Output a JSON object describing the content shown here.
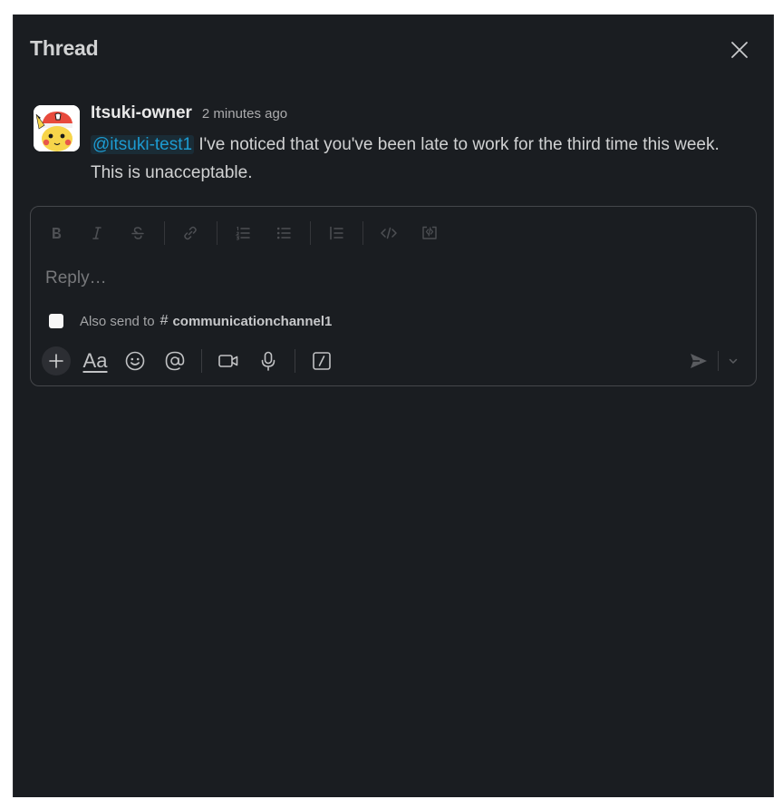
{
  "header": {
    "title": "Thread",
    "close_icon": "close-icon"
  },
  "message": {
    "author": "Itsuki-owner",
    "timestamp": "2 minutes ago",
    "mention": "@itsuki-test1",
    "text": " I've noticed that you've been late to work for the third time this week. This is unacceptable."
  },
  "composer": {
    "format_icons": [
      "bold-icon",
      "italic-icon",
      "strikethrough-icon",
      "link-icon",
      "ordered-list-icon",
      "bulleted-list-icon",
      "blockquote-icon",
      "code-icon",
      "code-block-icon"
    ],
    "placeholder": "Reply…",
    "also_send_label": "Also send to",
    "hash_symbol": "#",
    "channel_name": "communicationchannel1",
    "also_send_checked": false,
    "format_label": "Aa",
    "toolbar_icons": [
      "plus-icon",
      "format-icon",
      "emoji-icon",
      "mention-icon",
      "video-icon",
      "microphone-icon",
      "slash-command-icon",
      "send-icon",
      "chevron-down-icon"
    ]
  },
  "colors": {
    "panel_bg": "#1a1d21",
    "text_primary": "#d1d2d3",
    "mention": "#1d9bd1",
    "muted": "#ababad",
    "border": "#45474b"
  }
}
